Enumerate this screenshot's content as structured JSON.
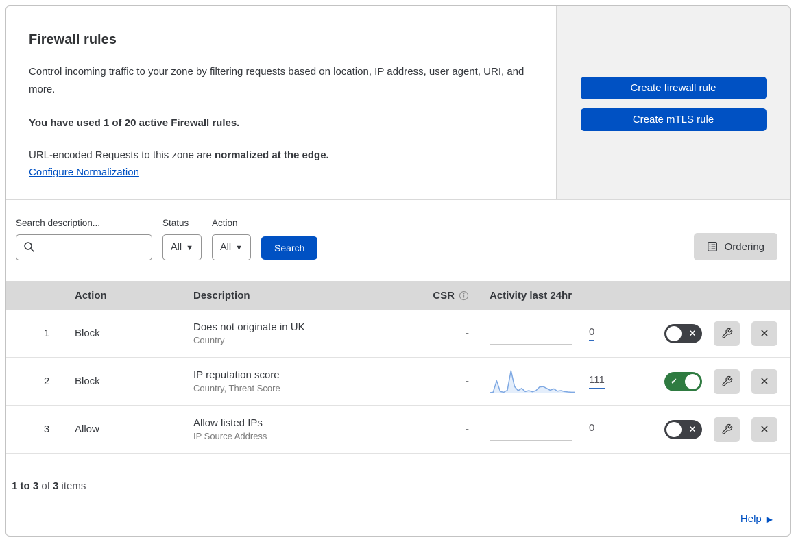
{
  "header": {
    "title": "Firewall rules",
    "description": "Control incoming traffic to your zone by filtering requests based on location, IP address, user agent, URI, and more.",
    "usage_notice": "You have used 1 of 20 active Firewall rules.",
    "normalization_prefix": "URL-encoded Requests to this zone are ",
    "normalization_bold": "normalized at the edge.",
    "configure_link": "Configure Normalization",
    "create_firewall_button": "Create firewall rule",
    "create_mtls_button": "Create mTLS rule"
  },
  "filters": {
    "search_label": "Search description...",
    "search_value": "",
    "status_label": "Status",
    "status_value": "All",
    "action_label": "Action",
    "action_value": "All",
    "search_button": "Search",
    "ordering_button": "Ordering"
  },
  "table": {
    "headers": {
      "action": "Action",
      "description": "Description",
      "csr": "CSR",
      "activity": "Activity last 24hr"
    },
    "rows": [
      {
        "index": "1",
        "action": "Block",
        "description": "Does not originate in UK",
        "criteria": "Country",
        "csr": "-",
        "activity_count": "0",
        "enabled": false
      },
      {
        "index": "2",
        "action": "Block",
        "description": "IP reputation score",
        "criteria": "Country, Threat Score",
        "csr": "-",
        "activity_count": "111",
        "enabled": true,
        "sparkline": [
          3,
          5,
          55,
          8,
          5,
          14,
          100,
          30,
          12,
          22,
          8,
          12,
          7,
          12,
          28,
          30,
          22,
          14,
          20,
          10,
          12,
          8,
          6,
          5,
          5
        ]
      },
      {
        "index": "3",
        "action": "Allow",
        "description": "Allow listed IPs",
        "criteria": "IP Source Address",
        "csr": "-",
        "activity_count": "0",
        "enabled": false
      }
    ]
  },
  "footer": {
    "range": "1 to 3",
    "of": " of ",
    "total": "3",
    "items": " items"
  },
  "help": {
    "label": "Help"
  },
  "colors": {
    "accent_blue": "#0051c3",
    "toggle_on_green": "#2f7b41",
    "toggle_off_gray": "#3e4045",
    "sparkline_stroke": "#7fa9e3",
    "sparkline_fill": "#e4eefb"
  }
}
